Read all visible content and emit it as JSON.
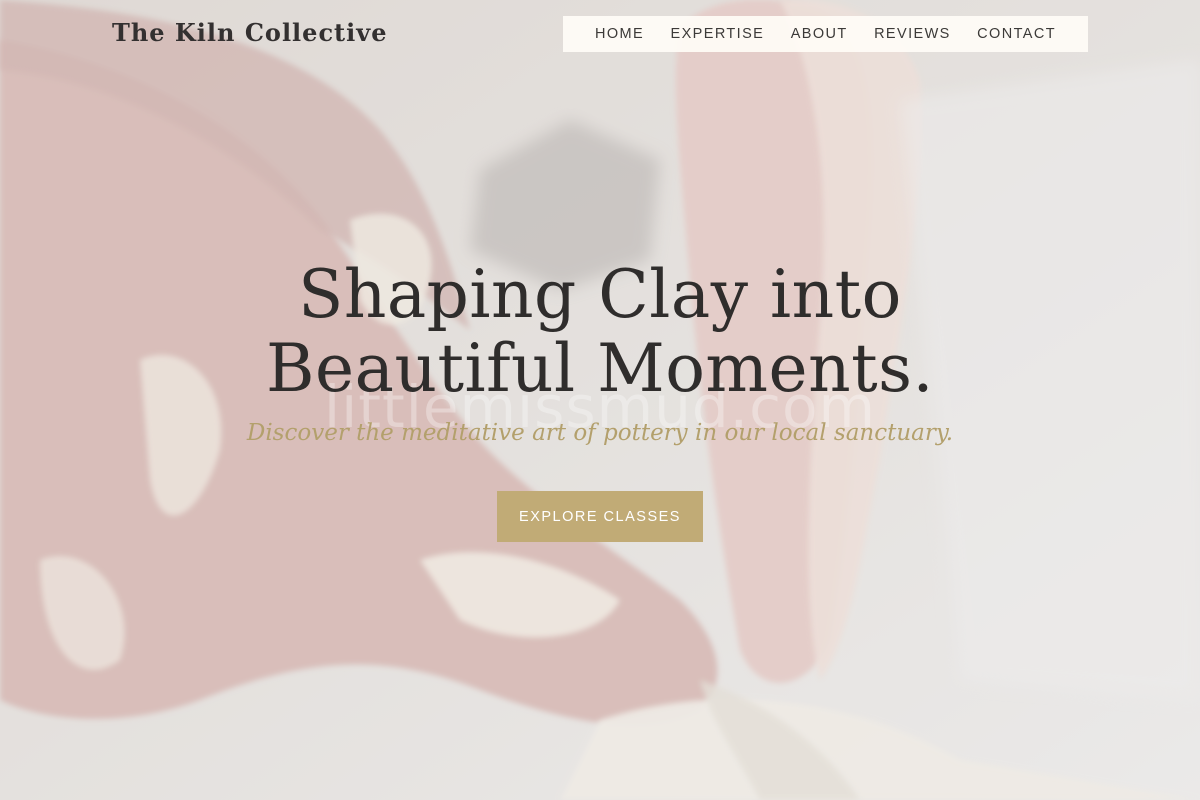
{
  "brand": {
    "name": "The Kiln Collective"
  },
  "nav": {
    "items": [
      {
        "label": "HOME"
      },
      {
        "label": "EXPERTISE"
      },
      {
        "label": "ABOUT"
      },
      {
        "label": "REVIEWS"
      },
      {
        "label": "CONTACT"
      }
    ]
  },
  "hero": {
    "headline_line1": "Shaping Clay into",
    "headline_line2": "Beautiful Moments.",
    "subheadline": "Discover the meditative art of pottery in our local sanctuary.",
    "watermark": "littlemissmud.com",
    "cta_label": "EXPLORE CLASSES",
    "background_image": "hands-shaping-clay-photo"
  },
  "colors": {
    "accent": "#c1ab76",
    "subheadline": "#b3a06c",
    "text_dark": "#2f2d2c",
    "nav_bg": "#fffcf6"
  }
}
